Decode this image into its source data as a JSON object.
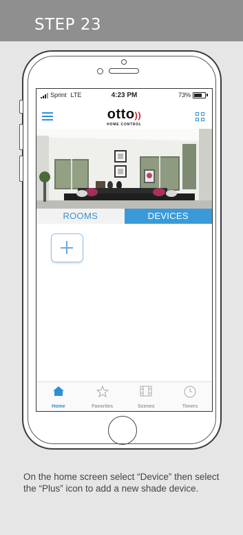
{
  "header": {
    "title": "STEP 23"
  },
  "status_bar": {
    "carrier": "Sprint",
    "network": "LTE",
    "time": "4:23 PM",
    "battery": "73%"
  },
  "app": {
    "logo_text": "otto",
    "logo_subtitle": "HOME CONTROL",
    "menu_icon": "hamburger-menu-icon",
    "grid_icon": "grid-view-icon"
  },
  "tabs": [
    {
      "label": "ROOMS",
      "active": false
    },
    {
      "label": "DEVICES",
      "active": true
    }
  ],
  "add_device": {
    "icon": "plus-icon"
  },
  "bottom_nav": [
    {
      "label": "Home",
      "icon": "home-icon",
      "active": true
    },
    {
      "label": "Favorites",
      "icon": "star-icon",
      "active": false
    },
    {
      "label": "Scenes",
      "icon": "film-icon",
      "active": false
    },
    {
      "label": "Timers",
      "icon": "clock-icon",
      "active": false
    }
  ],
  "caption": "On the home screen select “Device” then select the “Plus” icon to add a new shade device.",
  "colors": {
    "accent": "#3a9ad9",
    "header": "#8f8f8f",
    "background": "#e6e6e6"
  }
}
